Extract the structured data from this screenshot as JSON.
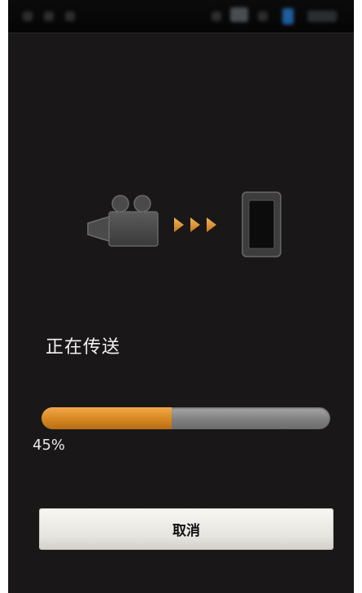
{
  "transfer": {
    "status_label": "正在传送",
    "progress_percent": 45,
    "progress_text": "45%",
    "cancel_label": "取消"
  },
  "icons": {
    "source": "video-camera-icon",
    "direction": "triple-arrow-right-icon",
    "target": "smartphone-icon"
  },
  "colors": {
    "background": "#1a1719",
    "accent": "#e39a37",
    "track": "#8a8a8a",
    "button": "#efede8"
  }
}
